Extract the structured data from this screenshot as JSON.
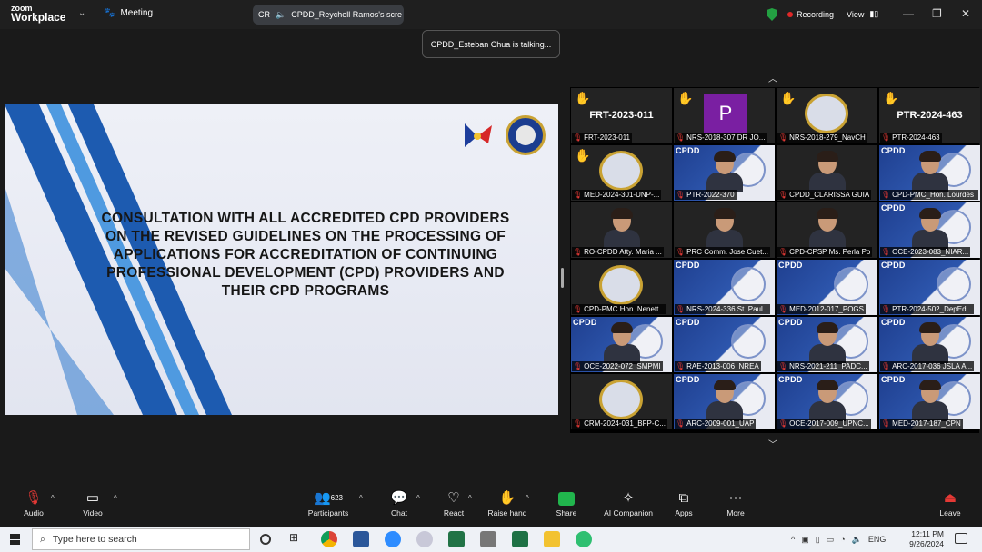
{
  "app": {
    "brand_top": "zoom",
    "brand_bottom": "Workplace",
    "meeting_label": "Meeting"
  },
  "screen_share": {
    "initials": "CR",
    "label": "CPDD_Reychell Ramos's scre"
  },
  "status": {
    "recording": "Recording",
    "view": "View"
  },
  "toast": "CPDD_Esteban Chua is talking...",
  "slide": {
    "title": "CONSULTATION WITH ALL ACCREDITED CPD PROVIDERS ON THE REVISED GUIDELINES ON THE PROCESSING OF APPLICATIONS FOR ACCREDITATION OF CONTINUING PROFESSIONAL DEVELOPMENT (CPD) PROVIDERS AND THEIR CPD PROGRAMS",
    "logo_text": "BAGONG PILIPINAS",
    "colors": {
      "stripe_dark": "#1d5bb0",
      "stripe_light": "#4f9ae0"
    }
  },
  "gallery": [
    {
      "label": "FRT-2023-011",
      "big": "FRT-2023-011",
      "hand": true,
      "type": "name"
    },
    {
      "label": "NRS-2018-307 DR JO...",
      "avatar": "P",
      "hand": true,
      "type": "letter"
    },
    {
      "label": "NRS-2018-279_NavCH",
      "hand": true,
      "type": "emblem"
    },
    {
      "label": "PTR-2024-463",
      "big": "PTR-2024-463",
      "hand": true,
      "type": "name"
    },
    {
      "label": "MED-2024-301-UNP-...",
      "hand": true,
      "type": "emblem"
    },
    {
      "label": "PTR-2022-370",
      "type": "cpdd-face",
      "badge": "CPDD"
    },
    {
      "label": "CPDD_CLARISSA GUIA",
      "type": "face"
    },
    {
      "label": "CPD-PMC_Hon. Lourdes ...",
      "type": "cpdd-face",
      "badge": "CPDD"
    },
    {
      "label": "RO-CPDD Atty. Maria ...",
      "type": "face"
    },
    {
      "label": "PRC Comm. Jose Cuet...",
      "type": "face"
    },
    {
      "label": "CPD-CPSP Ms. Perla Po",
      "type": "face"
    },
    {
      "label": "OCE-2023-083_NIAR...",
      "type": "cpdd-face",
      "badge": "CPDD"
    },
    {
      "label": "CPD-PMC Hon. Nenett...",
      "type": "emblem"
    },
    {
      "label": "NRS-2024-336 St. Paul...",
      "type": "cpdd",
      "badge": "CPDD"
    },
    {
      "label": "MED-2012-017_POGS",
      "type": "cpdd",
      "badge": "CPDD"
    },
    {
      "label": "PTR-2024-502_DepEd...",
      "type": "cpdd",
      "badge": "CPDD"
    },
    {
      "label": "OCE-2022-072_SMPMI",
      "type": "cpdd-face",
      "badge": "CPDD"
    },
    {
      "label": "RAE-2013-006_NREA",
      "type": "cpdd",
      "badge": "CPDD"
    },
    {
      "label": "NRS-2021-211_PADC...",
      "type": "cpdd-face",
      "badge": "CPDD"
    },
    {
      "label": "ARC-2017-036 JSLA A...",
      "type": "cpdd-face",
      "badge": "CPDD"
    },
    {
      "label": "CRM-2024-031_BFP-C...",
      "type": "emblem"
    },
    {
      "label": "ARC-2009-001_UAP",
      "type": "cpdd-face",
      "badge": "CPDD"
    },
    {
      "label": "OCE-2017-009_UPNC...",
      "type": "cpdd-face",
      "badge": "CPDD"
    },
    {
      "label": "MED-2017-187_CPN",
      "type": "cpdd-face",
      "badge": "CPDD"
    }
  ],
  "toolbar": {
    "audio": "Audio",
    "video": "Video",
    "participants": "Participants",
    "participants_count": "623",
    "chat": "Chat",
    "react": "React",
    "raise_hand": "Raise hand",
    "share": "Share",
    "ai": "AI Companion",
    "apps": "Apps",
    "more": "More",
    "leave": "Leave"
  },
  "taskbar": {
    "search_placeholder": "Type here to search",
    "lang": "ENG",
    "time": "12:11 PM",
    "date": "9/26/2024"
  }
}
